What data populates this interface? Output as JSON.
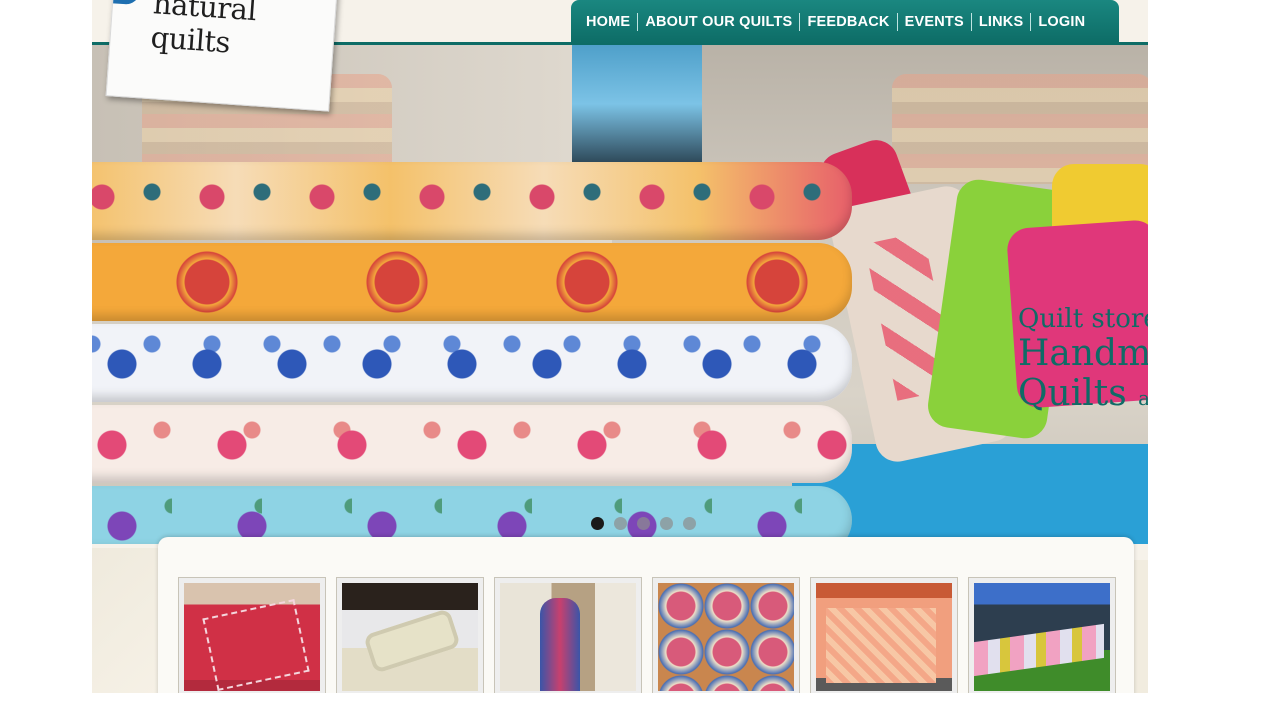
{
  "logo": {
    "text": "natural quilts"
  },
  "nav": {
    "items": [
      "HOME",
      "ABOUT OUR QUILTS",
      "FEEDBACK",
      "EVENTS",
      "LINKS",
      "LOGIN"
    ]
  },
  "hero": {
    "slogan_line1": "Quilt store",
    "slogan_line2": "Handma",
    "slogan_line3": "Quilts",
    "slogan_line3_tail": "an",
    "slides": 5,
    "active_slide": 1
  },
  "thumbnails": [
    "red-quilt-thumb",
    "white-quilt-bed-thumb",
    "person-in-quilt-thumb",
    "rolled-quilts-thumb",
    "orange-bedspread-thumb",
    "quilts-on-line-thumb"
  ],
  "colors": {
    "nav_bg": "#0d6c66",
    "accent_teal": "#0f6b66",
    "page_bg": "#ffffff"
  }
}
